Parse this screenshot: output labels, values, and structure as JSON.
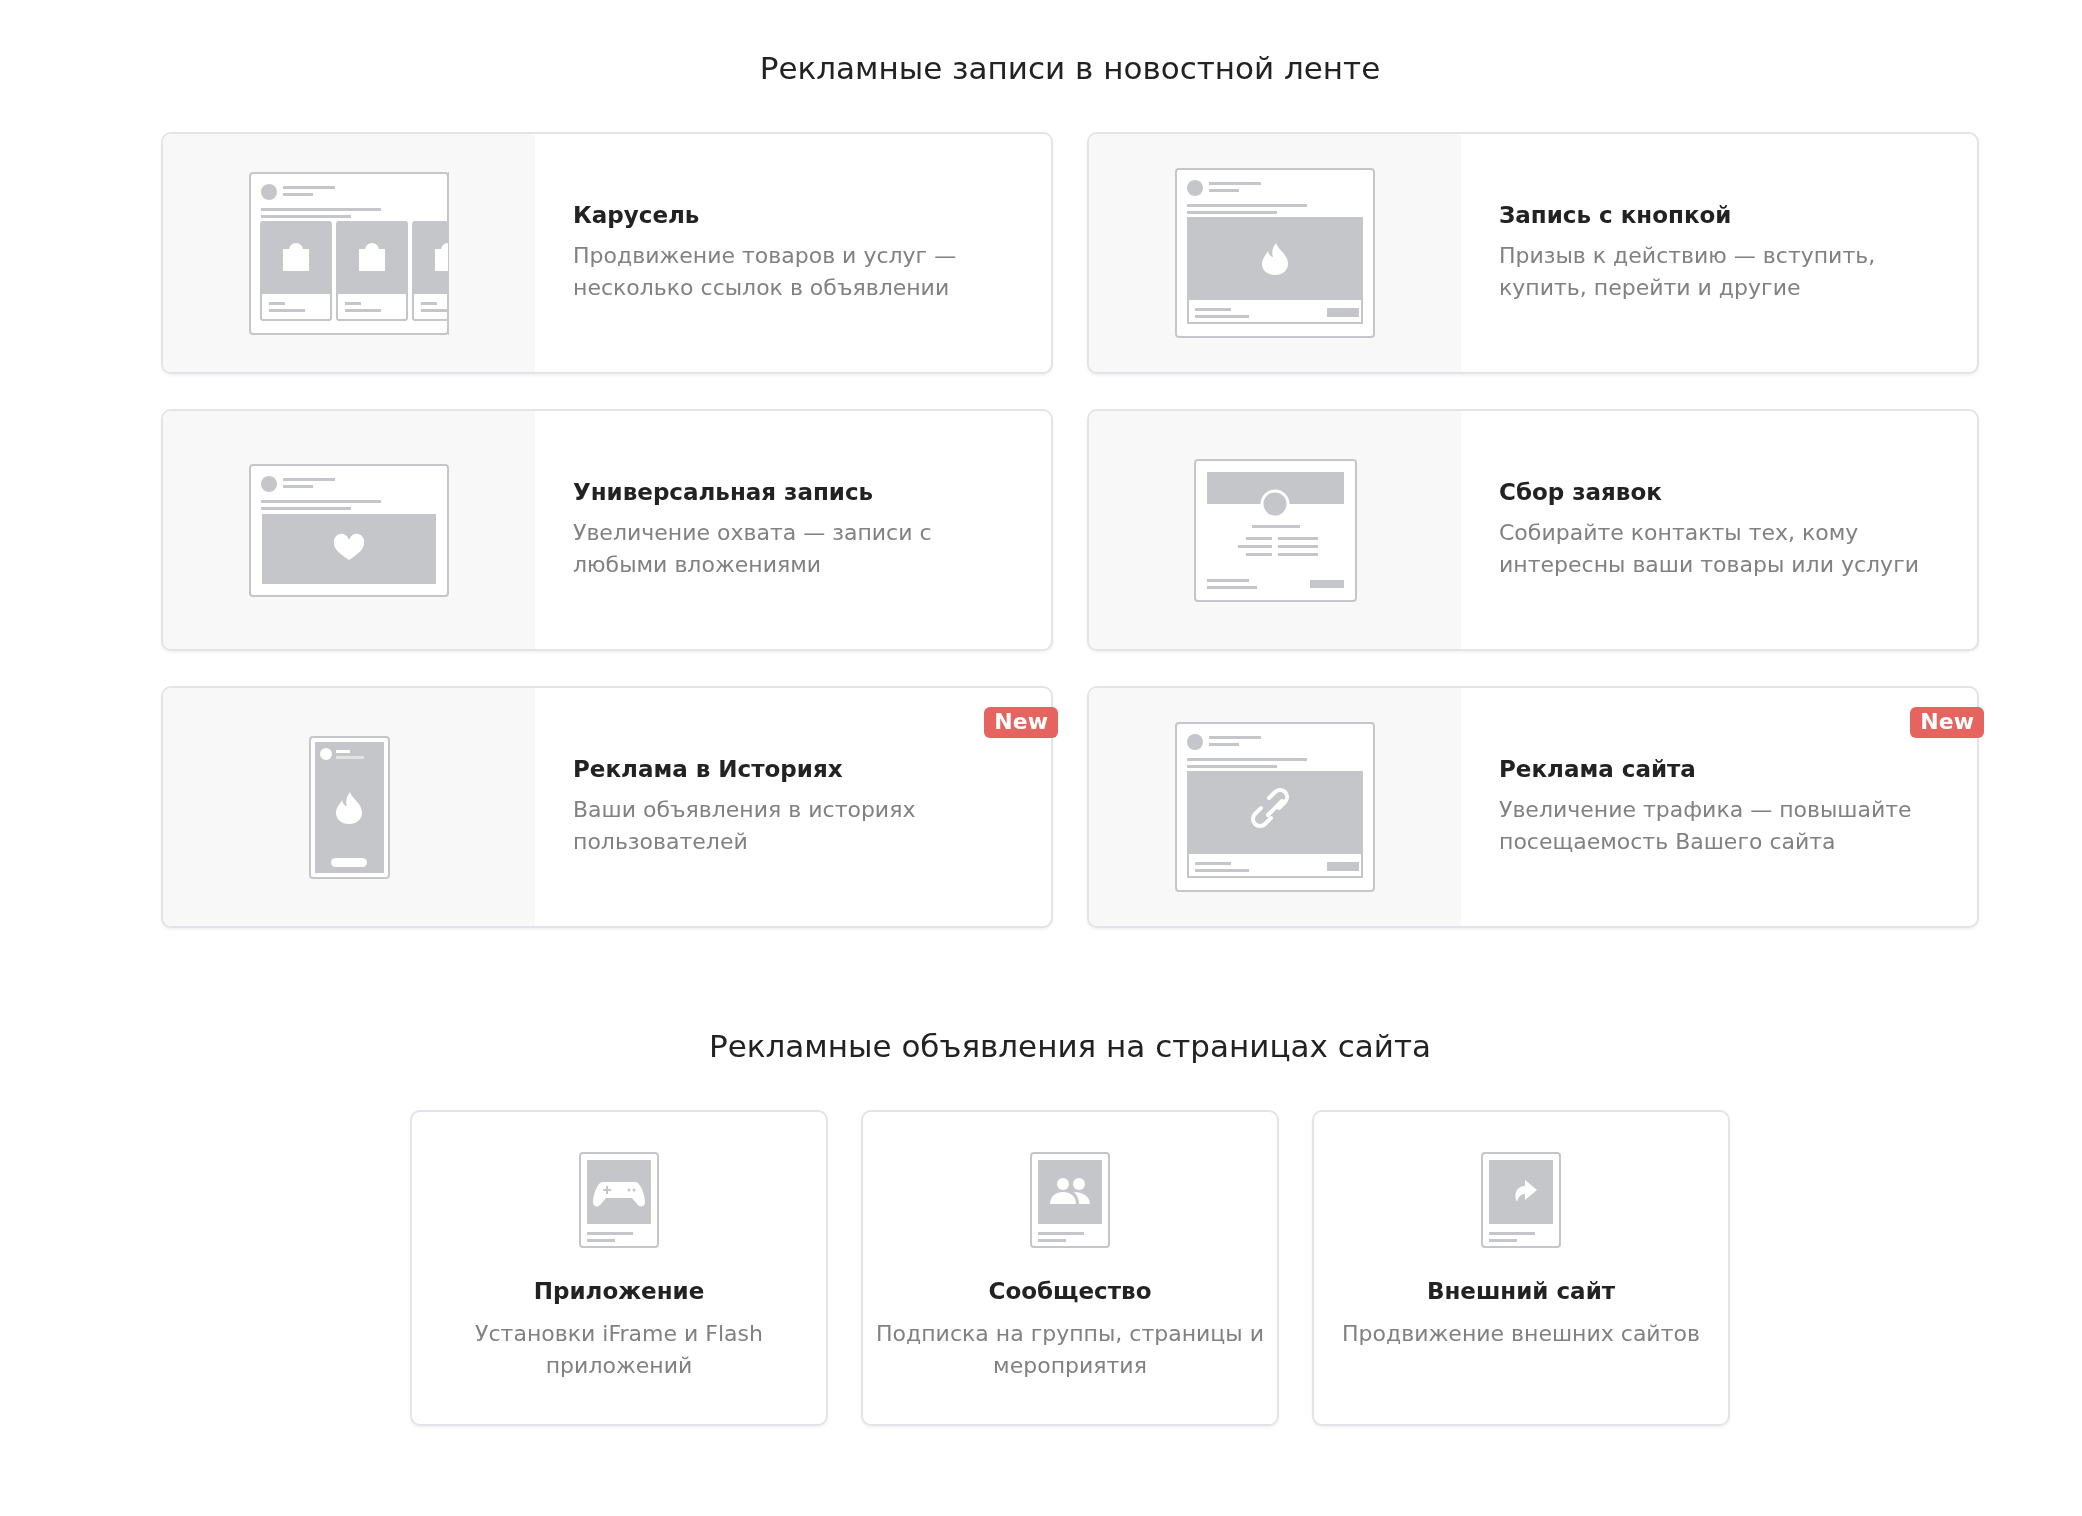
{
  "sections": [
    {
      "kind": "feed",
      "title": "Рекламные записи в новостной ленте",
      "cards": [
        {
          "kind": "carousel",
          "title": "Карусель",
          "description": "Продвижение товаров и услуг — несколько ссылок в объявлении"
        },
        {
          "kind": "button",
          "title": "Запись с кнопкой",
          "description": "Призыв к действию — вступить, купить, перейти и другие"
        },
        {
          "kind": "universal",
          "title": "Универсальная запись",
          "description": "Увеличение охвата — записи с любыми вложениями"
        },
        {
          "kind": "leads",
          "title": "Сбор заявок",
          "description": "Собирайте контакты тех, кому интересны ваши товары или услуги"
        },
        {
          "kind": "story",
          "title": "Реклама в Историях",
          "description": "Ваши объявления в историях пользователей",
          "badge": "New"
        },
        {
          "kind": "site",
          "title": "Реклама сайта",
          "description": "Увеличение трафика — повышайте посещаемость Вашего сайта",
          "badge": "New"
        }
      ]
    },
    {
      "kind": "pages",
      "title": "Рекламные объявления на страницах сайта",
      "cards": [
        {
          "kind": "app",
          "title": "Приложение",
          "description": "Установки iFrame и Flash приложений"
        },
        {
          "kind": "community",
          "title": "Сообщество",
          "description": "Подписка на группы, страницы и мероприятия"
        },
        {
          "kind": "external",
          "title": "Внешний сайт",
          "description": "Продвижение внешних сайтов"
        }
      ]
    }
  ]
}
